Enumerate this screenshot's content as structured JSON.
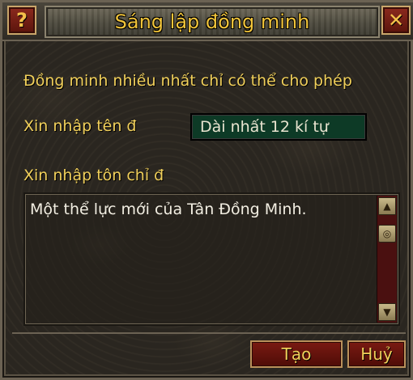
{
  "dialog": {
    "title": "Sáng lập đồng minh",
    "help_icon": "?",
    "close_icon": "✕"
  },
  "form": {
    "info_text": "Đồng minh nhiều nhất chỉ có thể cho phép",
    "name_label": "Xin nhập tên đ",
    "name_value": "Dài nhất 12 kí tự",
    "motto_label": "Xin nhập tôn chỉ đ",
    "motto_value": "Một thể lực mới của Tân Đồng Minh."
  },
  "scrollbar": {
    "up_icon": "▲",
    "thumb_icon": "◎",
    "down_icon": "▼"
  },
  "buttons": {
    "create_label": "Tạo",
    "cancel_label": "Huỷ"
  }
}
